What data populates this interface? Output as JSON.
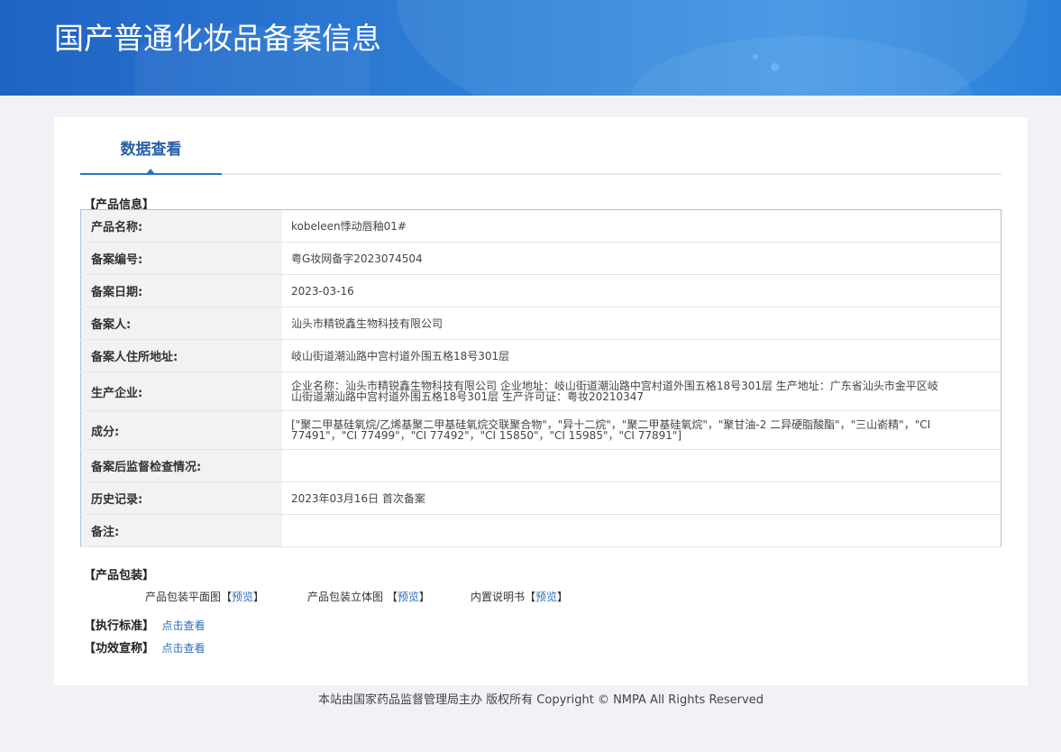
{
  "header": {
    "title": "国产普通化妆品备案信息"
  },
  "tab": {
    "label": "数据查看"
  },
  "product_info": {
    "section_label": "【产品信息】",
    "rows": [
      {
        "key": "产品名称:",
        "value": "kobeleen悸动唇釉01#"
      },
      {
        "key": "备案编号:",
        "value": "粤G妆网备字2023074504"
      },
      {
        "key": "备案日期:",
        "value": "2023-03-16"
      },
      {
        "key": "备案人:",
        "value": "汕头市精锐鑫生物科技有限公司"
      },
      {
        "key": "备案人住所地址:",
        "value": "岐山街道潮汕路中宫村道外围五格18号301层"
      },
      {
        "key": "生产企业:",
        "value": "企业名称：汕头市精锐鑫生物科技有限公司 企业地址：岐山街道潮汕路中宫村道外围五格18号301层 生产地址：广东省汕头市金平区岐山街道潮汕路中宫村道外围五格18号301层 生产许可证：粤妆20210347"
      },
      {
        "key": "成分:",
        "value": "[\"聚二甲基硅氧烷/乙烯基聚二甲基硅氧烷交联聚合物\"，\"异十二烷\"，\"聚二甲基硅氧烷\"，\"聚甘油-2 二异硬脂酸酯\"，\"三山嵛精\"，\"CI 77491\"，\"CI 77499\"，\"CI 77492\"，\"CI 15850\"，\"CI 15985\"，\"CI 77891\"]"
      },
      {
        "key": "备案后监督检查情况:",
        "value": ""
      },
      {
        "key": "历史记录:",
        "value": "2023年03月16日 首次备案"
      },
      {
        "key": "备注:",
        "value": ""
      }
    ]
  },
  "packaging": {
    "section_label": "【产品包装】",
    "items": [
      {
        "label": "产品包装平面图",
        "link": "预览"
      },
      {
        "label": "产品包装立体图 ",
        "link": "预览"
      },
      {
        "label": "内置说明书",
        "link": "预览"
      }
    ]
  },
  "standard": {
    "label": "【执行标准】",
    "link": "点击查看"
  },
  "efficacy": {
    "label": "【功效宣称】",
    "link": "点击查看"
  },
  "footer": {
    "text": "本站由国家药品监督管理局主办 版权所有 Copyright © NMPA All Rights Reserved"
  }
}
